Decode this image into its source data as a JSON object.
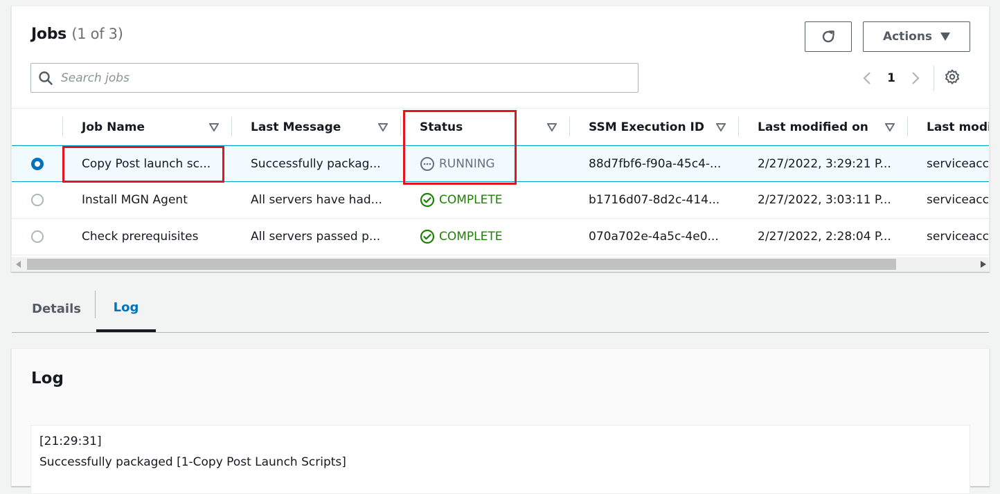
{
  "jobs": {
    "title": "Jobs",
    "count": "(1 of 3)",
    "actions_label": "Actions",
    "search_placeholder": "Search jobs",
    "page_number": "1",
    "columns": [
      "Job Name",
      "Last Message",
      "Status",
      "SSM Execution ID",
      "Last modified on",
      "Last modifi"
    ],
    "rows": [
      {
        "selected": true,
        "name": "Copy Post launch sc...",
        "message": "Successfully packag...",
        "status": "RUNNING",
        "ssm_id": "88d7fbf6-f90a-45c4-...",
        "modified": "2/27/2022, 3:29:21 P...",
        "modified_by": "serviceacco"
      },
      {
        "selected": false,
        "name": "Install MGN Agent",
        "message": "All servers have had...",
        "status": "COMPLETE",
        "ssm_id": "b1716d07-8d2c-414...",
        "modified": "2/27/2022, 3:03:11 P...",
        "modified_by": "serviceacco"
      },
      {
        "selected": false,
        "name": "Check prerequisites",
        "message": "All servers passed p...",
        "status": "COMPLETE",
        "ssm_id": "070a702e-4a5c-4e0...",
        "modified": "2/27/2022, 2:28:04 P...",
        "modified_by": "serviceacco"
      }
    ]
  },
  "tabs": [
    "Details",
    "Log"
  ],
  "active_tab": "Log",
  "log": {
    "title": "Log",
    "lines": [
      "[21:29:31]",
      "Successfully packaged [1-Copy Post Launch Scripts]"
    ]
  },
  "icons": {
    "refresh": "refresh-icon",
    "actions_caret": "caret-down-icon",
    "search": "search-icon",
    "prev": "chevron-left-icon",
    "next": "chevron-right-icon",
    "settings": "gear-icon",
    "sort": "sort-icon",
    "running": "in-progress-icon",
    "complete": "check-circle-icon"
  },
  "colors": {
    "running": "#687078",
    "complete": "#1d8102",
    "accent": "#0073bb",
    "highlight": "#e3141c"
  }
}
